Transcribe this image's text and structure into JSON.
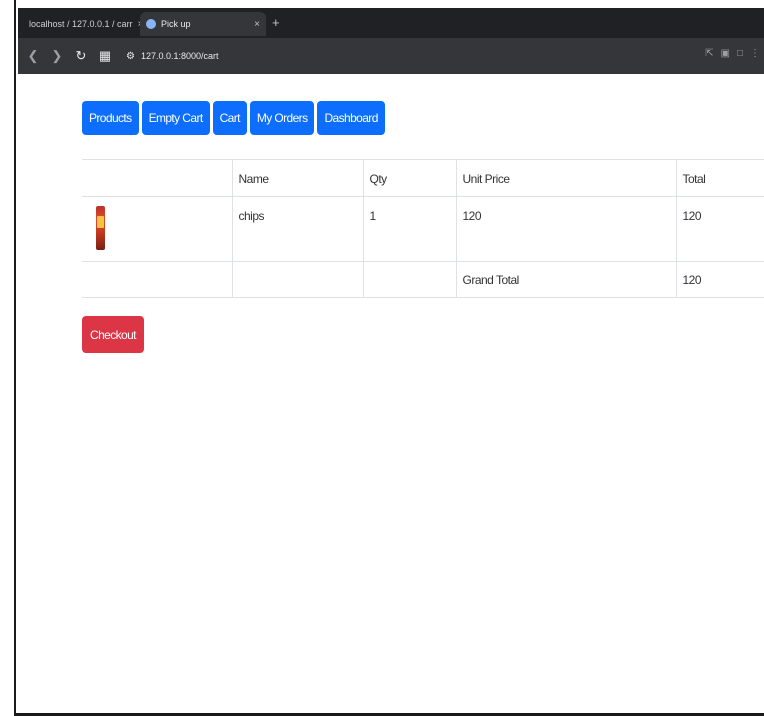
{
  "browser": {
    "tabs": [
      {
        "title": "localhost / 127.0.0.1 / carr",
        "favicon_color": "#f0a04b"
      },
      {
        "title": "Pick up",
        "favicon_color": "#8ab4f8"
      }
    ],
    "new_tab_glyph": "+",
    "close_glyph": "×",
    "address": "127.0.0.1:8000/cart",
    "nav_icons": [
      "back-icon",
      "forward-icon",
      "reload-icon",
      "grid-icon",
      "site-info-icon"
    ],
    "toolbar_icons": [
      "share-icon",
      "install-icon",
      "extensions-icon",
      "menu-icon"
    ]
  },
  "nav": {
    "products": "Products",
    "empty_cart": "Empty Cart",
    "cart": "Cart",
    "my_orders": "My Orders",
    "dashboard": "Dashboard"
  },
  "cart": {
    "headers": {
      "image": "",
      "name": "Name",
      "qty": "Qty",
      "unit_price": "Unit Price",
      "total": "Total"
    },
    "items": [
      {
        "image": "chips-can",
        "name": "chips",
        "qty": "1",
        "unit_price": "120",
        "total": "120"
      }
    ],
    "grand_total_label": "Grand Total",
    "grand_total": "120"
  },
  "checkout_label": "Checkout",
  "colors": {
    "primary": "#0d6efd",
    "danger": "#dc3545",
    "browser_bg": "#202124",
    "toolbar_bg": "#35363a"
  }
}
